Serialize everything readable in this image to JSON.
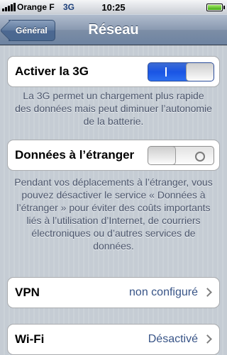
{
  "status_bar": {
    "carrier": "Orange F",
    "network": "3G",
    "time": "10:25",
    "battery_level": 1.0,
    "icons": [
      "signal-bars-icon",
      "battery-icon"
    ]
  },
  "nav": {
    "back_label": "Général",
    "title": "Réseau"
  },
  "settings": {
    "activate_3g": {
      "label": "Activer la 3G",
      "state": "on",
      "footer": "La 3G permet un chargement plus rapide des données mais peut diminuer l’autonomie de la batterie."
    },
    "roaming": {
      "label": "Données à l’étranger",
      "state": "off",
      "footer": "Pendant vos déplacements à l’étranger, vous pouvez désactiver le service « Données à l’étranger » pour éviter des coûts importants liés à l’utilisation d’Internet, de courriers électroniques ou d’autres services de données."
    },
    "vpn": {
      "label": "VPN",
      "value": "non configuré"
    },
    "wifi": {
      "label": "Wi-Fi",
      "value": "Désactivé"
    }
  },
  "colors": {
    "background": "#c5ccd4",
    "switch_on": "#1a55e4",
    "value_text": "#385487",
    "footer_text": "#4c566c"
  }
}
